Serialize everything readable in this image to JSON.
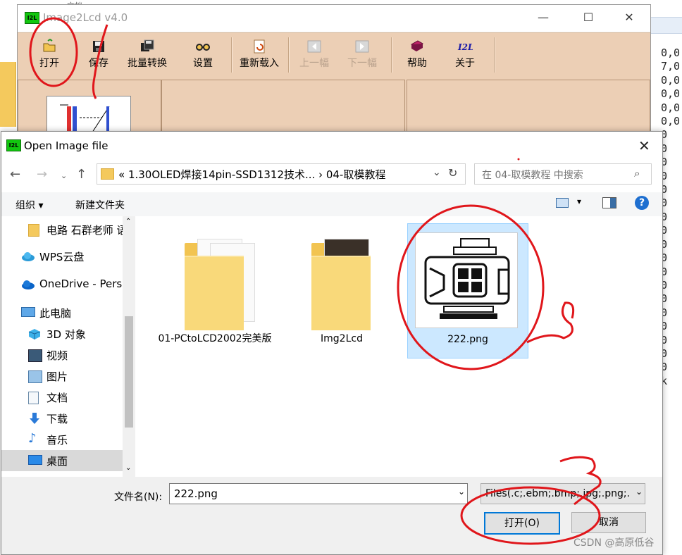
{
  "background": {
    "tab_label": "文档",
    "code_lines": [
      "0,0",
      "7,0",
      "0,0",
      "0,0",
      "0,0",
      "0,0",
      "0",
      "0",
      "0",
      "0",
      "0",
      "0",
      "0",
      "0",
      "0",
      "0",
      "0",
      "0",
      "0",
      "0",
      "0",
      "0",
      "0",
      "0",
      "k"
    ]
  },
  "app": {
    "logo_text": "I2L",
    "title": "Image2Lcd v4.0",
    "toolbar": [
      {
        "label": "打开",
        "icon": "open-folder-icon",
        "enabled": true
      },
      {
        "label": "保存",
        "icon": "save-disk-icon",
        "enabled": true
      },
      {
        "label": "批量转换",
        "icon": "batch-convert-icon",
        "enabled": true
      },
      {
        "label": "设置",
        "icon": "settings-glasses-icon",
        "enabled": true
      },
      {
        "label": "重新载入",
        "icon": "reload-icon",
        "enabled": true
      },
      {
        "label": "上一幅",
        "icon": "prev-image-icon",
        "enabled": false
      },
      {
        "label": "下一幅",
        "icon": "next-image-icon",
        "enabled": false
      },
      {
        "label": "帮助",
        "icon": "help-book-icon",
        "enabled": true
      },
      {
        "label": "关于",
        "icon": "about-i2l-icon",
        "enabled": true
      }
    ]
  },
  "dialog": {
    "logo_text": "I2L",
    "title": "Open Image file",
    "address": {
      "path": "«  1.30OLED焊接14pin-SSD1312技术...  ›  04-取模教程"
    },
    "search_placeholder": "在 04-取模教程 中搜索",
    "commands": {
      "organize": "组织 ▾",
      "new_folder": "新建文件夹"
    },
    "nav": [
      {
        "label": "电路 石群老师 语",
        "icon": "folder-icon"
      },
      {
        "label": "WPS云盘",
        "icon": "wps-cloud-icon"
      },
      {
        "label": "OneDrive - Perso",
        "icon": "onedrive-cloud-icon"
      },
      {
        "label": "此电脑",
        "icon": "this-pc-icon"
      },
      {
        "label": "3D 对象",
        "icon": "3d-objects-icon"
      },
      {
        "label": "视频",
        "icon": "video-icon"
      },
      {
        "label": "图片",
        "icon": "pictures-icon"
      },
      {
        "label": "文档",
        "icon": "documents-icon"
      },
      {
        "label": "下载",
        "icon": "download-icon"
      },
      {
        "label": "音乐",
        "icon": "music-icon"
      },
      {
        "label": "桌面",
        "icon": "desktop-icon"
      }
    ],
    "files": [
      {
        "name": "01-PCtoLCD2002完美版",
        "type": "folder"
      },
      {
        "name": "Img2Lcd",
        "type": "folder"
      },
      {
        "name": "222.png",
        "type": "image",
        "selected": true
      }
    ],
    "filename_label": "文件名(N):",
    "filename_value": "222.png",
    "filter": "Files(.c;.ebm;.bmp;.jpg;.png;.",
    "open_button": "打开(O)",
    "cancel_button": "取消"
  },
  "watermark": "CSDN @高原低谷",
  "colors": {
    "toolbar_bg": "#eccfb5",
    "annotation_red": "#e0161b",
    "selection": "#cce8ff",
    "accent": "#0078d7"
  }
}
